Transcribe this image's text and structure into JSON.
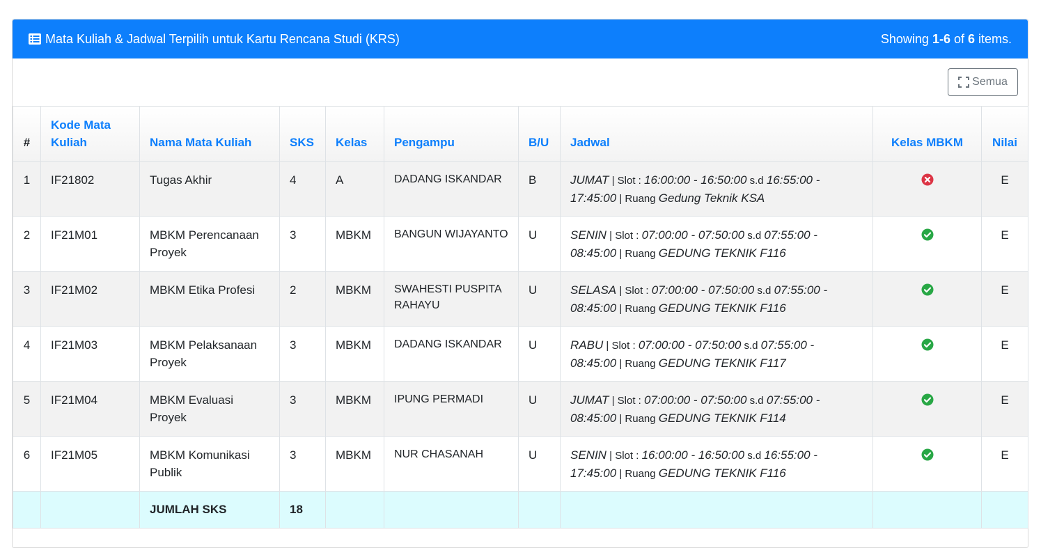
{
  "panel": {
    "title": "Mata Kuliah & Jadwal Terpilih untuk Kartu Rencana Studi (KRS)",
    "summary_prefix": "Showing ",
    "summary_range": "1-6",
    "summary_mid": " of ",
    "summary_total": "6",
    "summary_suffix": " items.",
    "header_color": "#0d7ffc"
  },
  "toolbar": {
    "semua_label": "Semua"
  },
  "table": {
    "headers": {
      "no": "#",
      "kode": "Kode Mata Kuliah",
      "nama": "Nama Mata Kuliah",
      "sks": "SKS",
      "kelas": "Kelas",
      "pengampu": "Pengampu",
      "bu": "B/U",
      "jadwal": "Jadwal",
      "mbkm": "Kelas MBKM",
      "nilai": "Nilai"
    },
    "slot_label": " | Slot : ",
    "sd_label": " s.d ",
    "ruang_label": " | Ruang ",
    "rows": [
      {
        "no": "1",
        "kode": "IF21802",
        "nama": "Tugas Akhir",
        "sks": "4",
        "kelas": "A",
        "pengampu": "DADANG ISKANDAR",
        "bu": "B",
        "hari": "JUMAT",
        "mulai": "16:00:00 - 16:50:00",
        "selesai": "16:55:00 - 17:45:00",
        "ruang": "Gedung Teknik KSA",
        "mbkm": "times-circle-icon",
        "nilai": "E"
      },
      {
        "no": "2",
        "kode": "IF21M01",
        "nama": "MBKM Perencanaan Proyek",
        "sks": "3",
        "kelas": "MBKM",
        "pengampu": "BANGUN WIJAYANTO",
        "bu": "U",
        "hari": "SENIN",
        "mulai": "07:00:00 - 07:50:00",
        "selesai": "07:55:00 - 08:45:00",
        "ruang": "GEDUNG TEKNIK F116",
        "mbkm": "check-circle-icon",
        "nilai": "E"
      },
      {
        "no": "3",
        "kode": "IF21M02",
        "nama": "MBKM Etika Profesi",
        "sks": "2",
        "kelas": "MBKM",
        "pengampu": "SWAHESTI PUSPITA RAHAYU",
        "bu": "U",
        "hari": "SELASA",
        "mulai": "07:00:00 - 07:50:00",
        "selesai": "07:55:00 - 08:45:00",
        "ruang": "GEDUNG TEKNIK F116",
        "mbkm": "check-circle-icon",
        "nilai": "E"
      },
      {
        "no": "4",
        "kode": "IF21M03",
        "nama": "MBKM Pelaksanaan Proyek",
        "sks": "3",
        "kelas": "MBKM",
        "pengampu": "DADANG ISKANDAR",
        "bu": "U",
        "hari": "RABU",
        "mulai": "07:00:00 - 07:50:00",
        "selesai": "07:55:00 - 08:45:00",
        "ruang": "GEDUNG TEKNIK F117",
        "mbkm": "check-circle-icon",
        "nilai": "E"
      },
      {
        "no": "5",
        "kode": "IF21M04",
        "nama": "MBKM Evaluasi Proyek",
        "sks": "3",
        "kelas": "MBKM",
        "pengampu": "IPUNG PERMADI",
        "bu": "U",
        "hari": "JUMAT",
        "mulai": "07:00:00 - 07:50:00",
        "selesai": "07:55:00 - 08:45:00",
        "ruang": "GEDUNG TEKNIK F114",
        "mbkm": "check-circle-icon",
        "nilai": "E"
      },
      {
        "no": "6",
        "kode": "IF21M05",
        "nama": "MBKM Komunikasi Publik",
        "sks": "3",
        "kelas": "MBKM",
        "pengampu": "NUR CHASANAH",
        "bu": "U",
        "hari": "SENIN",
        "mulai": "16:00:00 - 16:50:00",
        "selesai": "16:55:00 - 17:45:00",
        "ruang": "GEDUNG TEKNIK F116",
        "mbkm": "check-circle-icon",
        "nilai": "E"
      }
    ],
    "footer": {
      "label": "JUMLAH SKS",
      "total": "18"
    }
  },
  "colors": {
    "check": "#28a745",
    "times": "#dc3545",
    "footer_bg": "#dcfcfe"
  }
}
